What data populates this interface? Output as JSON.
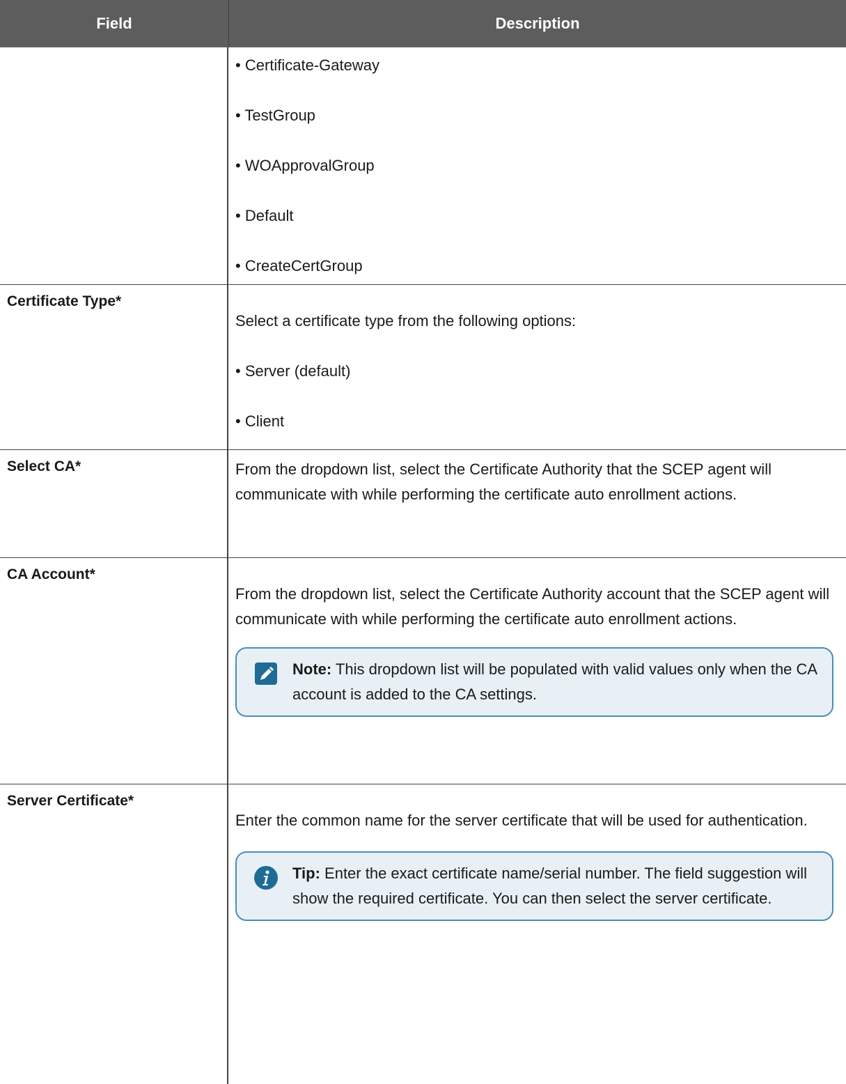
{
  "header": {
    "field": "Field",
    "description": "Description"
  },
  "rows": [
    {
      "field": "",
      "items": [
        "• Certificate-Gateway",
        "• TestGroup",
        "• WOApprovalGroup",
        "• Default",
        "• CreateCertGroup"
      ]
    },
    {
      "field": "Certificate Type*",
      "text": "Select a certificate type from the following options:",
      "items": [
        "• Server (default)",
        "• Client"
      ]
    },
    {
      "field": "Select CA*",
      "text": "From the dropdown list, select the Certificate Authority that the SCEP agent will communicate with while performing the certificate auto enrollment actions."
    },
    {
      "field": "CA Account*",
      "text": "From the dropdown list, select the Certificate Authority account that the SCEP agent will communicate with while performing the certificate auto enrollment actions.",
      "note_label": "Note:",
      "note_text": " This dropdown list will be populated with valid values only when the CA account is added to the CA settings.",
      "note_icon": "pencil-icon"
    },
    {
      "field": "Server Certificate*",
      "text": "Enter the common name for the server certificate that will be used for authentication.",
      "tip_label": "Tip:",
      "tip_text": " Enter the exact certificate name/serial number. The field suggestion will show the required certificate. You can then select the server certificate.",
      "tip_icon": "info-icon"
    }
  ],
  "colors": {
    "header_bg": "#5d5d5d",
    "note_border": "#4a8fb5",
    "note_bg": "#e8f0f5",
    "icon": "#1e6b96"
  }
}
